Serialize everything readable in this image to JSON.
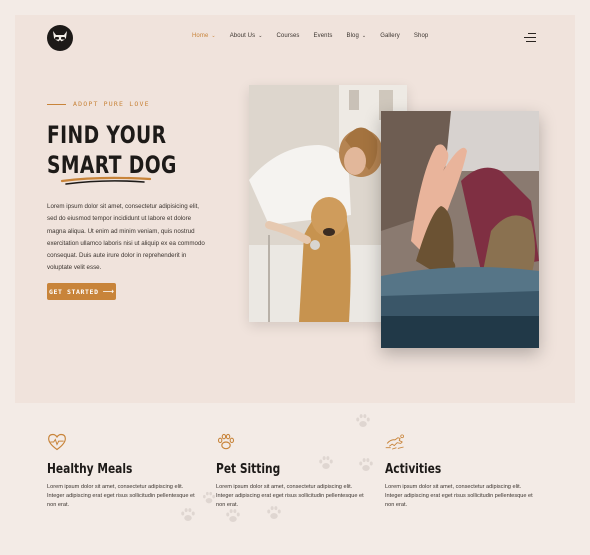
{
  "header": {
    "nav": [
      {
        "label": "Home",
        "dropdown": true,
        "active": true
      },
      {
        "label": "About Us",
        "dropdown": true,
        "active": false
      },
      {
        "label": "Courses",
        "dropdown": false,
        "active": false
      },
      {
        "label": "Events",
        "dropdown": false,
        "active": false
      },
      {
        "label": "Blog",
        "dropdown": true,
        "active": false
      },
      {
        "label": "Gallery",
        "dropdown": false,
        "active": false
      },
      {
        "label": "Shop",
        "dropdown": false,
        "active": false
      }
    ]
  },
  "hero": {
    "eyebrow": "ADOPT PURE LOVE",
    "title_line1": "FIND YOUR",
    "title_line2": "SMART DOG",
    "body": "Lorem ipsum dolor sit amet, consectetur adipisicing elit, sed do eiusmod tempor incididunt ut labore et dolore magna aliqua. Ut enim ad minim veniam, quis nostrud exercitation ullamco laboris nisi ut aliquip ex ea commodo consequat. Duis aute irure dolor in reprehenderit in voluptate velit esse.",
    "cta_label": "GET STARTED"
  },
  "features": [
    {
      "title": "Healthy Meals",
      "icon": "heart-pulse-icon",
      "body": "Lorem ipsum dolor sit amet, consectetur adipiscing elit. Integer adipiscing erat eget risus sollicitudin pellentesque et non erat."
    },
    {
      "title": "Pet Sitting",
      "icon": "paw-icon",
      "body": "Lorem ipsum dolor sit amet, consectetur adipiscing elit. Integer adipiscing erat eget risus sollicitudin pellentesque et non erat."
    },
    {
      "title": "Activities",
      "icon": "dog-jump-icon",
      "body": "Lorem ipsum dolor sit amet, consectetur adipiscing elit. Integer adipiscing erat eget risus sollicitudin pellentesque et non erat."
    }
  ],
  "colors": {
    "accent": "#c8843a",
    "dark": "#1d1a18",
    "hero_bg": "#f0e3dc",
    "page_bg": "#f3ebe6"
  }
}
